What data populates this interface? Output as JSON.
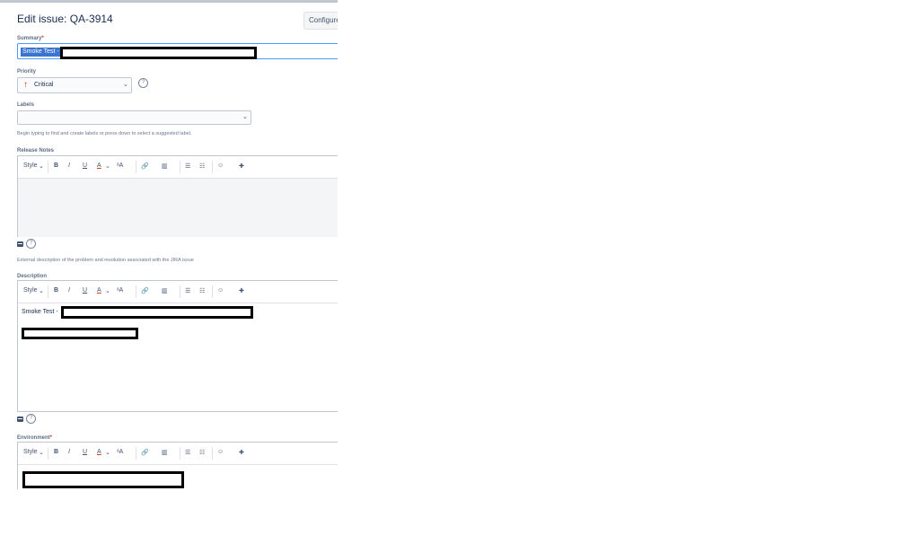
{
  "dialog": {
    "title": "Edit issue: QA-3914",
    "configure_label": "Configure"
  },
  "summary": {
    "label": "Summary",
    "required_mark": "*",
    "value": "Smoke Test -"
  },
  "priority": {
    "label": "Priority",
    "value": "Critical",
    "help": "?"
  },
  "labels": {
    "label": "Labels",
    "hint": "Begin typing to find and create labels or press down to select a suggested label."
  },
  "release_notes": {
    "label": "Release Notes",
    "hint": "External description of the problem and resolution associated with the JIRA issue"
  },
  "description": {
    "label": "Description",
    "text": "Smoke Test -"
  },
  "environment": {
    "label": "Environment",
    "required_mark": "*"
  },
  "toolbar": {
    "style": "Style",
    "bold": "B",
    "italic": "I",
    "underline": "U",
    "text_color": "A",
    "more_format": "ᵃA",
    "link": "🔗",
    "attachment": "▥",
    "bullet_list": "☰",
    "numbered_list": "☷",
    "emoji": "☺",
    "insert": "✚"
  },
  "icons": {
    "chevron": "⌄",
    "help": "?",
    "priority_arrow": "↑"
  },
  "colors": {
    "accent": "#4c9aff",
    "selection": "#3b73d1",
    "critical": "#de350b"
  }
}
